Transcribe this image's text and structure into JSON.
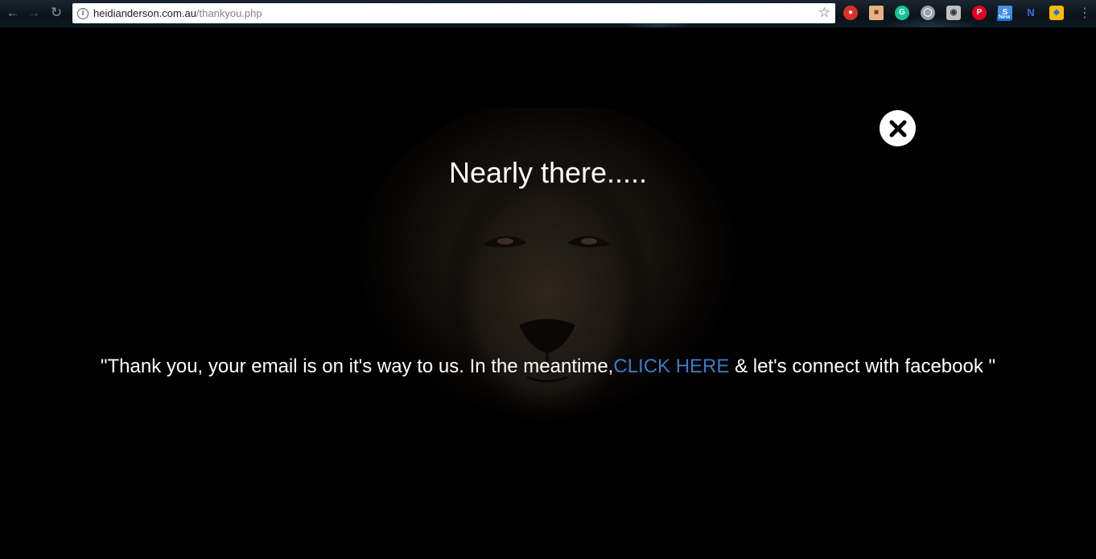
{
  "browser": {
    "url_host": "heidianderson.com.au",
    "url_path": "/thankyou.php",
    "icons": {
      "back": "back-arrow-icon",
      "forward": "forward-arrow-icon",
      "reload": "reload-icon",
      "info": "info-icon",
      "bookmark": "star-icon",
      "menu": "kebab-menu-icon"
    },
    "extensions": {
      "ext1": "shield-extension-icon",
      "ext2": "face-extension-icon",
      "grammarly": "G",
      "ext4": "clock-extension-icon",
      "camera": "camera-extension-icon",
      "pinterest": "P",
      "new_badge": "New",
      "n_ext": "N",
      "ext9": "puzzle-extension-icon"
    }
  },
  "popup": {
    "title": "Nearly there.....",
    "message_before": "\"Thank you, your email is on it's way to us. In the meantime,",
    "link_text": "CLICK HERE",
    "message_after": " & let's connect with facebook \"",
    "close_icon": "close-x-icon",
    "background_image": "lion-face-image"
  },
  "colors": {
    "background": "#000000",
    "text": "#ffffff",
    "link": "#3d7ac5"
  }
}
